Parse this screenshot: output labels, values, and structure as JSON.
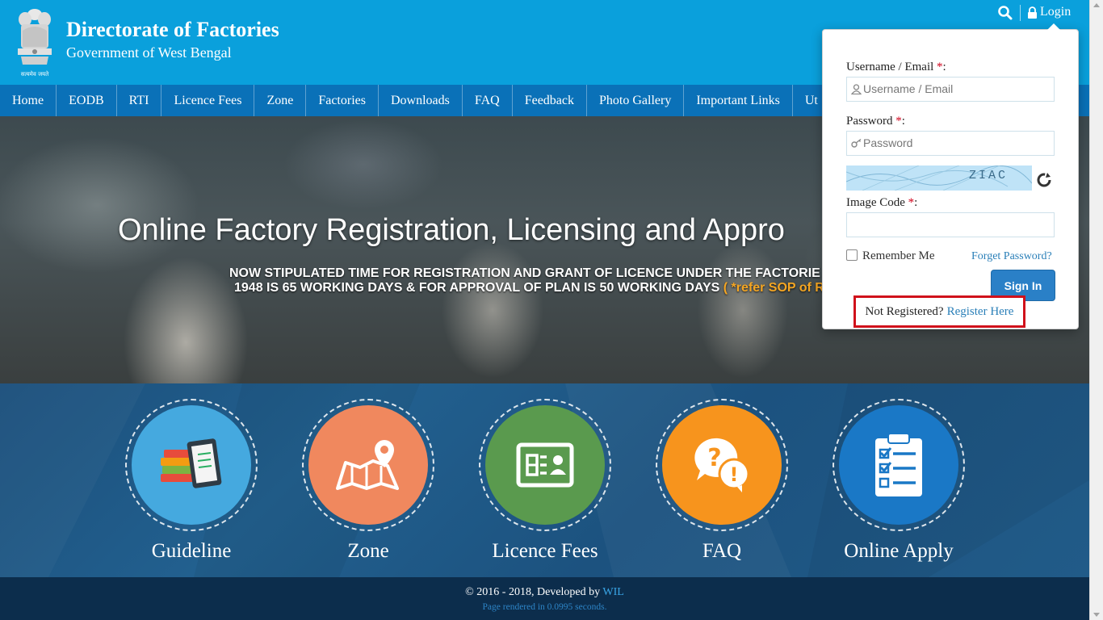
{
  "header": {
    "title": "Directorate of Factories",
    "subtitle": "Government of West Bengal",
    "emblem_motto": "सत्यमेव जयते",
    "login_label": "Login"
  },
  "nav": {
    "items": [
      {
        "label": "Home"
      },
      {
        "label": "EODB"
      },
      {
        "label": "RTI"
      },
      {
        "label": "Licence Fees"
      },
      {
        "label": "Zone"
      },
      {
        "label": "Factories"
      },
      {
        "label": "Downloads"
      },
      {
        "label": "FAQ"
      },
      {
        "label": "Feedback"
      },
      {
        "label": "Photo Gallery"
      },
      {
        "label": "Important Links"
      },
      {
        "label": "Ut"
      }
    ]
  },
  "hero": {
    "title": "Online Factory Registration, Licensing and Appro",
    "line1": "NOW STIPULATED TIME FOR REGISTRATION AND GRANT OF LICENCE UNDER THE FACTORIE",
    "line2": "1948 IS 65 WORKING DAYS & FOR APPROVAL OF PLAN IS 50 WORKING DAYS",
    "line2_ref": "( *refer SOP of R"
  },
  "features": [
    {
      "label": "Guideline",
      "icon": "books-tablet-icon",
      "color": "#45a9df"
    },
    {
      "label": "Zone",
      "icon": "map-pin-icon",
      "color": "#f0885e"
    },
    {
      "label": "Licence Fees",
      "icon": "id-card-icon",
      "color": "#5a9a4e"
    },
    {
      "label": "FAQ",
      "icon": "question-chat-icon",
      "color": "#f7941d"
    },
    {
      "label": "Online Apply",
      "icon": "clipboard-checklist-icon",
      "color": "#1a78c6"
    }
  ],
  "footer": {
    "copyright": "© 2016 - 2018, Developed by",
    "developer": "WIL",
    "render_time": "Page rendered in 0.0995 seconds."
  },
  "login": {
    "username_label": "Username / Email",
    "username_placeholder": "Username / Email",
    "password_label": "Password",
    "password_placeholder": "Password",
    "image_code_label": "Image Code",
    "captcha_text": "ZIAC",
    "required_mark": "*",
    "label_suffix": ":",
    "remember_me": "Remember Me",
    "forget_password": "Forget Password?",
    "sign_in": "Sign In",
    "not_registered": "Not Registered?",
    "register_here": "Register Here"
  }
}
